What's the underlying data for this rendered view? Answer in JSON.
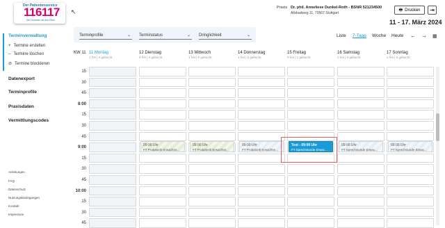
{
  "logo": {
    "top": "Der Patientenservice",
    "number": "116117",
    "sub": "Die Nummer mit den Elfen"
  },
  "header": {
    "praxis_label": "Praxis",
    "doctor": "Dr. phil. Anneliese Dunkel-Roth - BSNR 521234500",
    "address": "Allsbadweg 11, 70567 Stuttgart",
    "print_label": "Drucken",
    "date_range": "11 - 17. März 2024"
  },
  "sidebar": {
    "section_termin": "Terminverwaltung",
    "create": "Termine erstellen",
    "delete": "Termine löschen",
    "block": "Termine blockieren",
    "export": "Datenexport",
    "profiles": "Terminprofile",
    "praxisdaten": "Praxisdaten",
    "codes": "Vermittlungscodes",
    "footer": [
      "Anleitungen",
      "FAQ",
      "Datenschutz",
      "Nutzungsbedingungen",
      "Kontakt",
      "Impressum"
    ]
  },
  "toolbar": {
    "dd_profile": "Terminprofile",
    "dd_status": "Terminstatus",
    "dd_urgency": "Dringlichkeit",
    "view_list": "Liste",
    "view_7": "7-Tage",
    "view_week": "Woche",
    "view_today": "Heute"
  },
  "calendar": {
    "kw": "KW 11",
    "days": [
      {
        "label": "11 Montag",
        "sub": "1 frei | 0 gebucht"
      },
      {
        "label": "12 Dienstag",
        "sub": "0 frei | 0 gebucht"
      },
      {
        "label": "13 Mittwoch",
        "sub": "1 frei | 0 gebucht"
      },
      {
        "label": "14 Donnerstag",
        "sub": "1 frei | 0 gebucht"
      },
      {
        "label": "15 Freitag",
        "sub": "0 frei | 1 gebucht"
      },
      {
        "label": "16 Samstag",
        "sub": "1 frei | 0 gebucht"
      },
      {
        "label": "17 Sonntag",
        "sub": "1 frei | 0 gebucht"
      }
    ],
    "times": [
      "15",
      "30",
      "45",
      "8:00",
      "15",
      "30",
      "45",
      "9:00",
      "15",
      "30",
      "45",
      "10:00",
      "15",
      "30",
      "45"
    ],
    "appointments": [
      {
        "time": "09:00 Uhr",
        "desc": "FT Probatorik Erwachse..."
      },
      {
        "time": "09:00 Uhr",
        "desc": "FT Probatorik Erwachse..."
      },
      {
        "time": "09:00 Uhr",
        "desc": "FT Probatorik Erwachse..."
      },
      {
        "time": "Test - 09:00 Uhr",
        "desc": "FT Sprechstunde Erwac..."
      },
      {
        "time": "09:00 Uhr",
        "desc": "FT Sprechstunde Erwac..."
      },
      {
        "time": "09:00 Uhr",
        "desc": "FT Sprechstunde Erwac..."
      }
    ]
  }
}
